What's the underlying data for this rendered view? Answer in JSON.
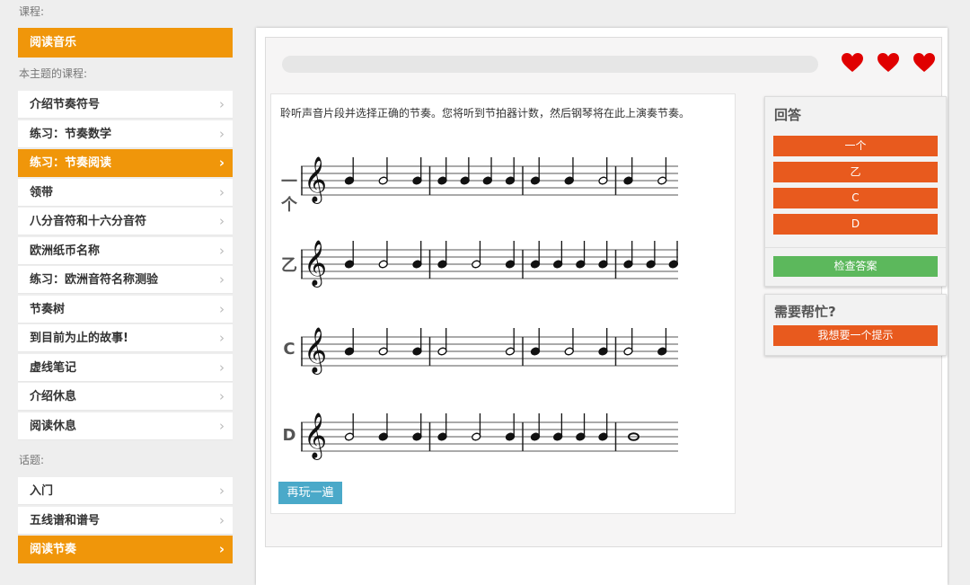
{
  "sidebar": {
    "course_label": "课程:",
    "course_item": "阅读音乐",
    "lessons_label": "本主题的课程:",
    "lessons": [
      {
        "label": "介绍节奏符号"
      },
      {
        "label": "练习：节奏数学"
      },
      {
        "label": "练习：节奏阅读",
        "active": true
      },
      {
        "label": "领带"
      },
      {
        "label": "八分音符和十六分音符"
      },
      {
        "label": "欧洲纸币名称"
      },
      {
        "label": "练习：欧洲音符名称测验"
      },
      {
        "label": "节奏树"
      },
      {
        "label": "到目前为止的故事!"
      },
      {
        "label": "虚线笔记"
      },
      {
        "label": "介绍休息"
      },
      {
        "label": "阅读休息"
      }
    ],
    "topics_label": "话题:",
    "topics": [
      {
        "label": "入门"
      },
      {
        "label": "五线谱和谱号"
      },
      {
        "label": "阅读节奏",
        "active": true
      }
    ],
    "chevron": "›"
  },
  "main": {
    "progress": 0,
    "lives": 3,
    "heart_color": "#e00000",
    "question_text": "聆听声音片段并选择正确的节奏。您将听到节拍器计数，然后钢琴将在此上演奏节奏。",
    "options": [
      {
        "label": "一个",
        "measures": [
          [
            "q",
            "h",
            "q"
          ],
          [
            "q",
            "q",
            "q",
            "q"
          ],
          [
            "q",
            "q",
            "h"
          ],
          [
            "q",
            "h",
            "q"
          ]
        ]
      },
      {
        "label": "乙",
        "measures": [
          [
            "q",
            "h",
            "q"
          ],
          [
            "q",
            "h",
            "q"
          ],
          [
            "q",
            "q",
            "q",
            "q"
          ],
          [
            "q",
            "q",
            "q",
            "q"
          ]
        ]
      },
      {
        "label": "C",
        "measures": [
          [
            "q",
            "h",
            "q"
          ],
          [
            "h",
            "h"
          ],
          [
            "q",
            "h",
            "q"
          ],
          [
            "h",
            "q",
            "q"
          ]
        ]
      },
      {
        "label": "D",
        "measures": [
          [
            "h",
            "q",
            "q"
          ],
          [
            "q",
            "h",
            "q"
          ],
          [
            "q",
            "q",
            "q",
            "q"
          ],
          [
            "w"
          ]
        ]
      }
    ],
    "replay_label": "再玩一遍"
  },
  "answer_panel": {
    "title": "回答",
    "options": [
      "一个",
      "乙",
      "C",
      "D"
    ],
    "check_label": "检查答案"
  },
  "help_panel": {
    "title": "需要帮忙?",
    "hint_label": "我想要一个提示"
  },
  "colors": {
    "accent_orange": "#f0960a",
    "answer_red": "#e85a1e",
    "check_green": "#5cb85c",
    "replay_blue": "#4aa9c9"
  }
}
